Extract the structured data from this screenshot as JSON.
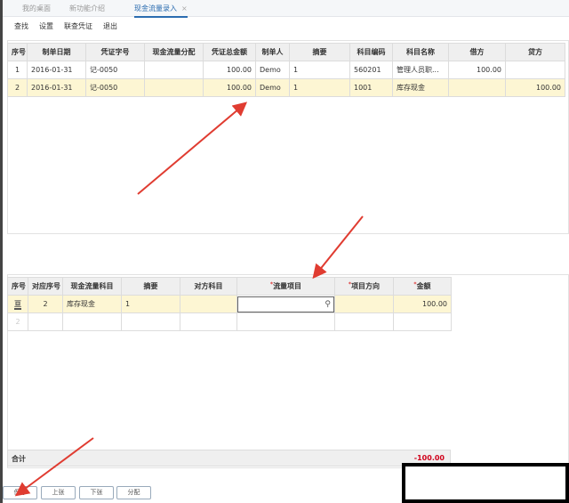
{
  "tabs": [
    {
      "label": "我的桌面"
    },
    {
      "label": "新功能介绍"
    },
    {
      "label": "现金流量录入",
      "close": "×"
    }
  ],
  "toolbar": [
    "查找",
    "设置",
    "联查凭证",
    "退出"
  ],
  "top_grid": {
    "headers": [
      "序号",
      "制单日期",
      "凭证字号",
      "现金流量分配",
      "凭证总金额",
      "制单人",
      "摘要",
      "科目编码",
      "科目名称",
      "借方",
      "贷方"
    ],
    "rows": [
      [
        "1",
        "2016-01-31",
        "记-0050",
        "",
        "100.00",
        "Demo",
        "1",
        "560201",
        "管理人员职...",
        "100.00",
        ""
      ],
      [
        "2",
        "2016-01-31",
        "记-0050",
        "",
        "100.00",
        "Demo",
        "1",
        "1001",
        "库存现金",
        "",
        "100.00"
      ]
    ]
  },
  "bottom_grid": {
    "headers": [
      "序号",
      "对应序号",
      "现金流量科目",
      "摘要",
      "对方科目",
      "流量项目",
      "项目方向",
      "金额"
    ],
    "required_mark": "*",
    "rows": [
      [
        "",
        "2",
        "库存现金",
        "1",
        "",
        "",
        "",
        "100.00"
      ],
      [
        "2",
        "",
        "",
        "",
        "",
        "",
        "",
        ""
      ]
    ]
  },
  "total": {
    "label": "合计",
    "value": "-100.00"
  },
  "buttons": [
    "保存",
    "上张",
    "下张",
    "分配"
  ],
  "colors": {
    "accent": "#2b6cb0",
    "selected_row": "#fdf6d3",
    "total_red": "#d0021b",
    "arrow": "#e03c31"
  }
}
